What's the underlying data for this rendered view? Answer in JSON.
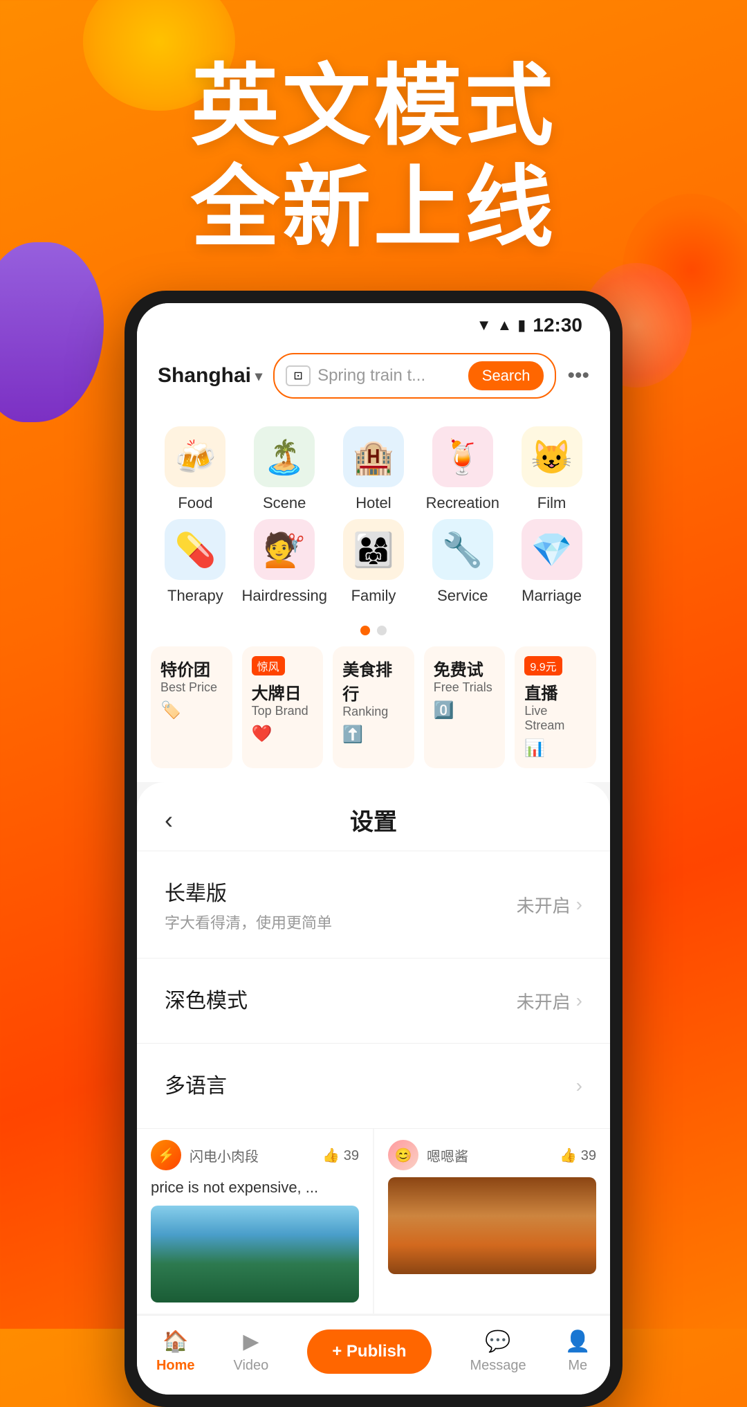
{
  "background": {
    "gradient_start": "#ff8c00",
    "gradient_end": "#ff4500"
  },
  "hero": {
    "line1": "英文模式",
    "line2": "全新上线"
  },
  "phone": {
    "status_bar": {
      "time": "12:30"
    },
    "header": {
      "location": "Shanghai",
      "search_placeholder": "Spring train t...",
      "search_button": "Search",
      "more_icon": "•••"
    },
    "categories_row1": [
      {
        "label": "Food",
        "emoji": "🍻",
        "bg": "#fff3e0"
      },
      {
        "label": "Scene",
        "emoji": "🏝️",
        "bg": "#e8f5e9"
      },
      {
        "label": "Hotel",
        "emoji": "🏨",
        "bg": "#e3f2fd"
      },
      {
        "label": "Recreation",
        "emoji": "🍹",
        "bg": "#fce4ec"
      },
      {
        "label": "Film",
        "emoji": "😺",
        "bg": "#fff8e1"
      }
    ],
    "categories_row2": [
      {
        "label": "Therapy",
        "emoji": "💊",
        "bg": "#e3f2fd"
      },
      {
        "label": "Hairdressing",
        "emoji": "💇",
        "bg": "#fce4ec"
      },
      {
        "label": "Family",
        "emoji": "👨‍👩‍👧",
        "bg": "#fff3e0"
      },
      {
        "label": "Service",
        "emoji": "🔧",
        "bg": "#e1f5fe"
      },
      {
        "label": "Marriage",
        "emoji": "💎",
        "bg": "#fce4ec"
      }
    ],
    "promo_cards": [
      {
        "badge": "",
        "title_cn": "特价团",
        "title_en": "Best Price",
        "emoji": "🏷️"
      },
      {
        "badge": "惊风",
        "title_cn": "大牌日",
        "title_en": "Top Brand",
        "emoji": "❤️"
      },
      {
        "badge": "",
        "title_cn": "美食排行",
        "title_en": "Ranking",
        "emoji": "⬆️"
      },
      {
        "badge": "",
        "title_cn": "免费试",
        "title_en": "Free Trials",
        "emoji": "0️⃣"
      },
      {
        "badge": "9.9元",
        "title_cn": "直播",
        "title_en": "Live Stream",
        "emoji": "📊"
      }
    ],
    "settings": {
      "title": "设置",
      "back_label": "‹",
      "items": [
        {
          "title": "长辈版",
          "subtitle": "字大看得清，使用更简单",
          "status": "未开启"
        },
        {
          "title": "深色模式",
          "subtitle": "",
          "status": "未开启"
        },
        {
          "title": "多语言",
          "subtitle": "",
          "status": ""
        }
      ]
    },
    "content_preview": [
      {
        "title": "price is not expensive, ...",
        "username": "闪电小肉段",
        "likes": "39",
        "has_image": false
      },
      {
        "title": "",
        "username": "嗯嗯酱",
        "likes": "39",
        "has_image": true
      }
    ],
    "bottom_nav": [
      {
        "label": "Home",
        "icon": "🏠",
        "active": true
      },
      {
        "label": "Video",
        "icon": "▶️",
        "active": false
      },
      {
        "label": "Publish",
        "icon": "+",
        "is_publish": true
      },
      {
        "label": "Message",
        "icon": "💬",
        "active": false
      },
      {
        "label": "Me",
        "icon": "👤",
        "active": false
      }
    ],
    "publish_btn": "+ Publish"
  }
}
